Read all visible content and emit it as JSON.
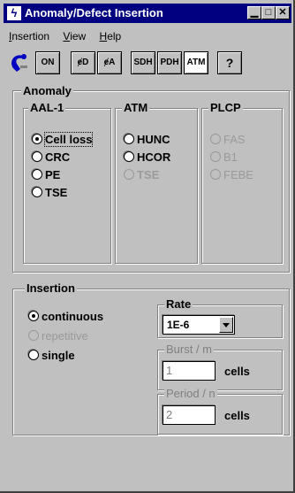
{
  "window": {
    "title": "Anomaly/Defect Insertion",
    "title_icon": "lightning-icon"
  },
  "title_buttons": {
    "minimize": "▁",
    "maximize": "□",
    "close": "✕"
  },
  "menu": [
    {
      "label": "Insertion",
      "accel": "I"
    },
    {
      "label": "View",
      "accel": "V"
    },
    {
      "label": "Help",
      "accel": "H"
    }
  ],
  "toolbar": {
    "on": "ON",
    "defect": "ɇD",
    "anomaly": "ɇA",
    "sdh": "SDH",
    "pdh": "PDH",
    "atm": "ATM",
    "help": "?"
  },
  "anomaly": {
    "label": "Anomaly",
    "aal1": {
      "label": "AAL-1",
      "options": [
        "Cell loss",
        "CRC",
        "PE",
        "TSE"
      ],
      "selected": 0
    },
    "atm": {
      "label": "ATM",
      "options": [
        "HUNC",
        "HCOR",
        "TSE"
      ]
    },
    "plcp": {
      "label": "PLCP",
      "options": [
        "FAS",
        "B1",
        "FEBE"
      ]
    }
  },
  "insertion": {
    "label": "Insertion",
    "options": [
      "continuous",
      "repetitive",
      "single"
    ],
    "selected": 0,
    "rate": {
      "label": "Rate",
      "value": "1E-6"
    },
    "burst": {
      "label": "Burst / m",
      "value": "1",
      "unit": "cells"
    },
    "period": {
      "label": "Period / n",
      "value": "2",
      "unit": "cells"
    }
  }
}
